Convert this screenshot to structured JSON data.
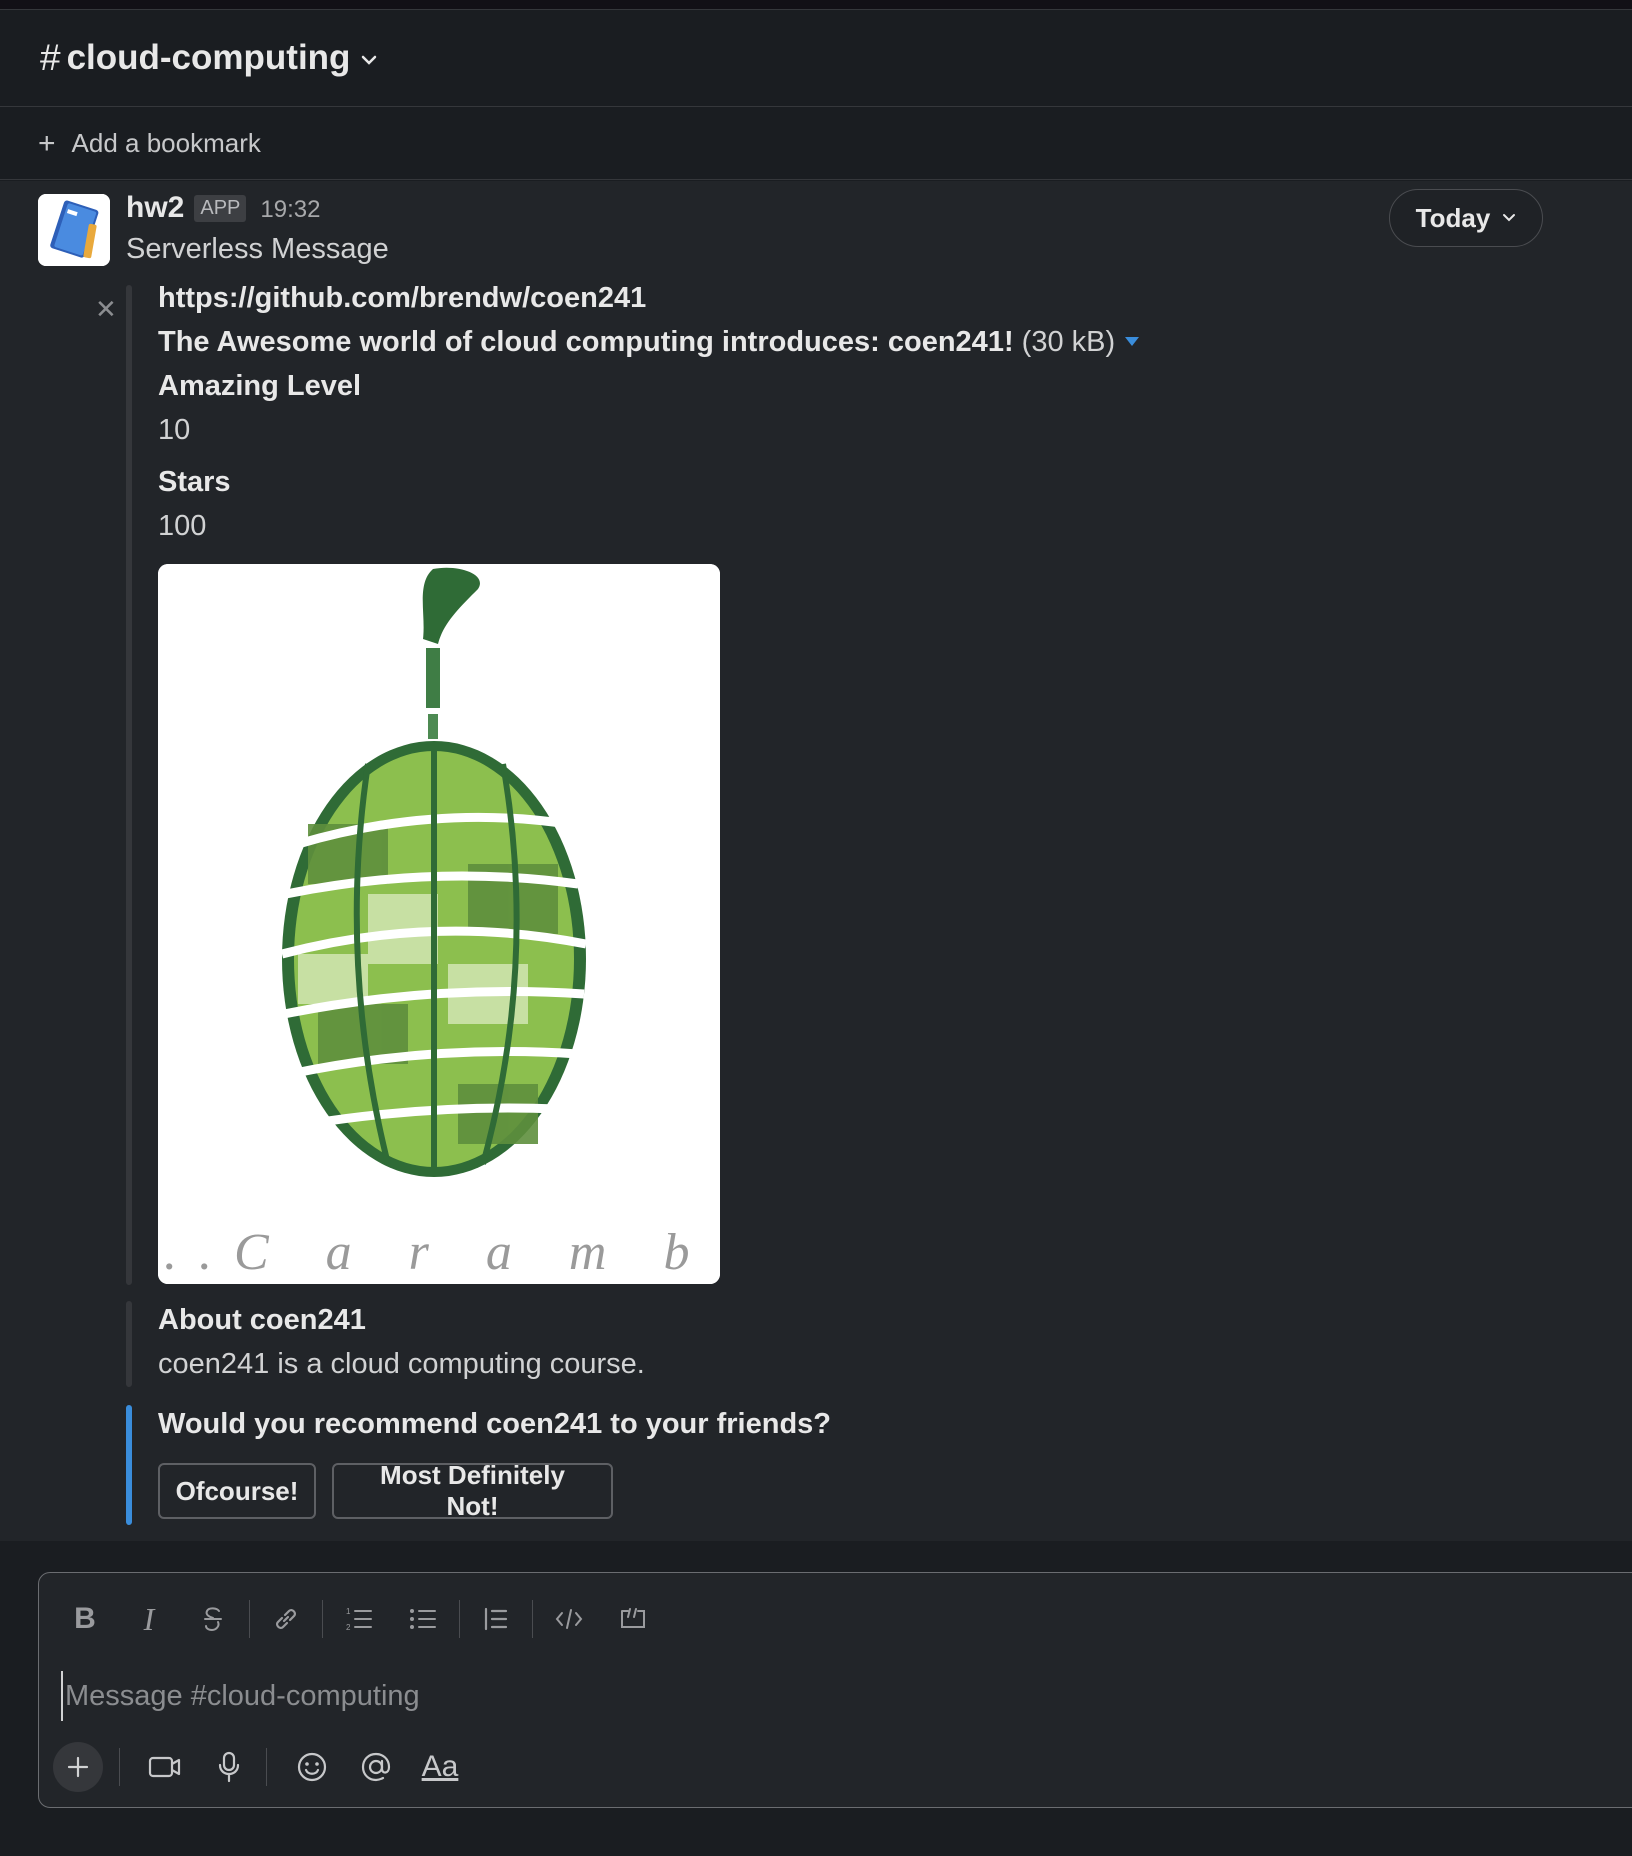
{
  "channel": {
    "name": "cloud-computing"
  },
  "bookmark": {
    "label": "Add a bookmark"
  },
  "message": {
    "sender": "hw2",
    "badge": "APP",
    "time": "19:32",
    "text": "Serverless Message",
    "date_divider": "Today"
  },
  "attachment": {
    "link": "https://github.com/brendw/coen241",
    "title": "The Awesome world of cloud computing introduces: coen241!",
    "file_size": "(30 kB)",
    "fields": [
      {
        "label": "Amazing Level",
        "value": "10"
      },
      {
        "label": "Stars",
        "value": "100"
      }
    ],
    "image_caption": "..C a r a m b o l a..."
  },
  "about": {
    "title": "About coen241",
    "text": "coen241 is a cloud computing course."
  },
  "question": {
    "text": "Would you recommend coen241 to your friends?",
    "buttons": [
      "Ofcourse!",
      "Most Definitely Not!"
    ]
  },
  "composer": {
    "placeholder": "Message #cloud-computing",
    "format_label": "Aa"
  },
  "colors": {
    "background": "#1a1d21",
    "messages_bg": "#222529",
    "accent_blue": "#3a8ddb",
    "text": "#d1d2d3"
  }
}
